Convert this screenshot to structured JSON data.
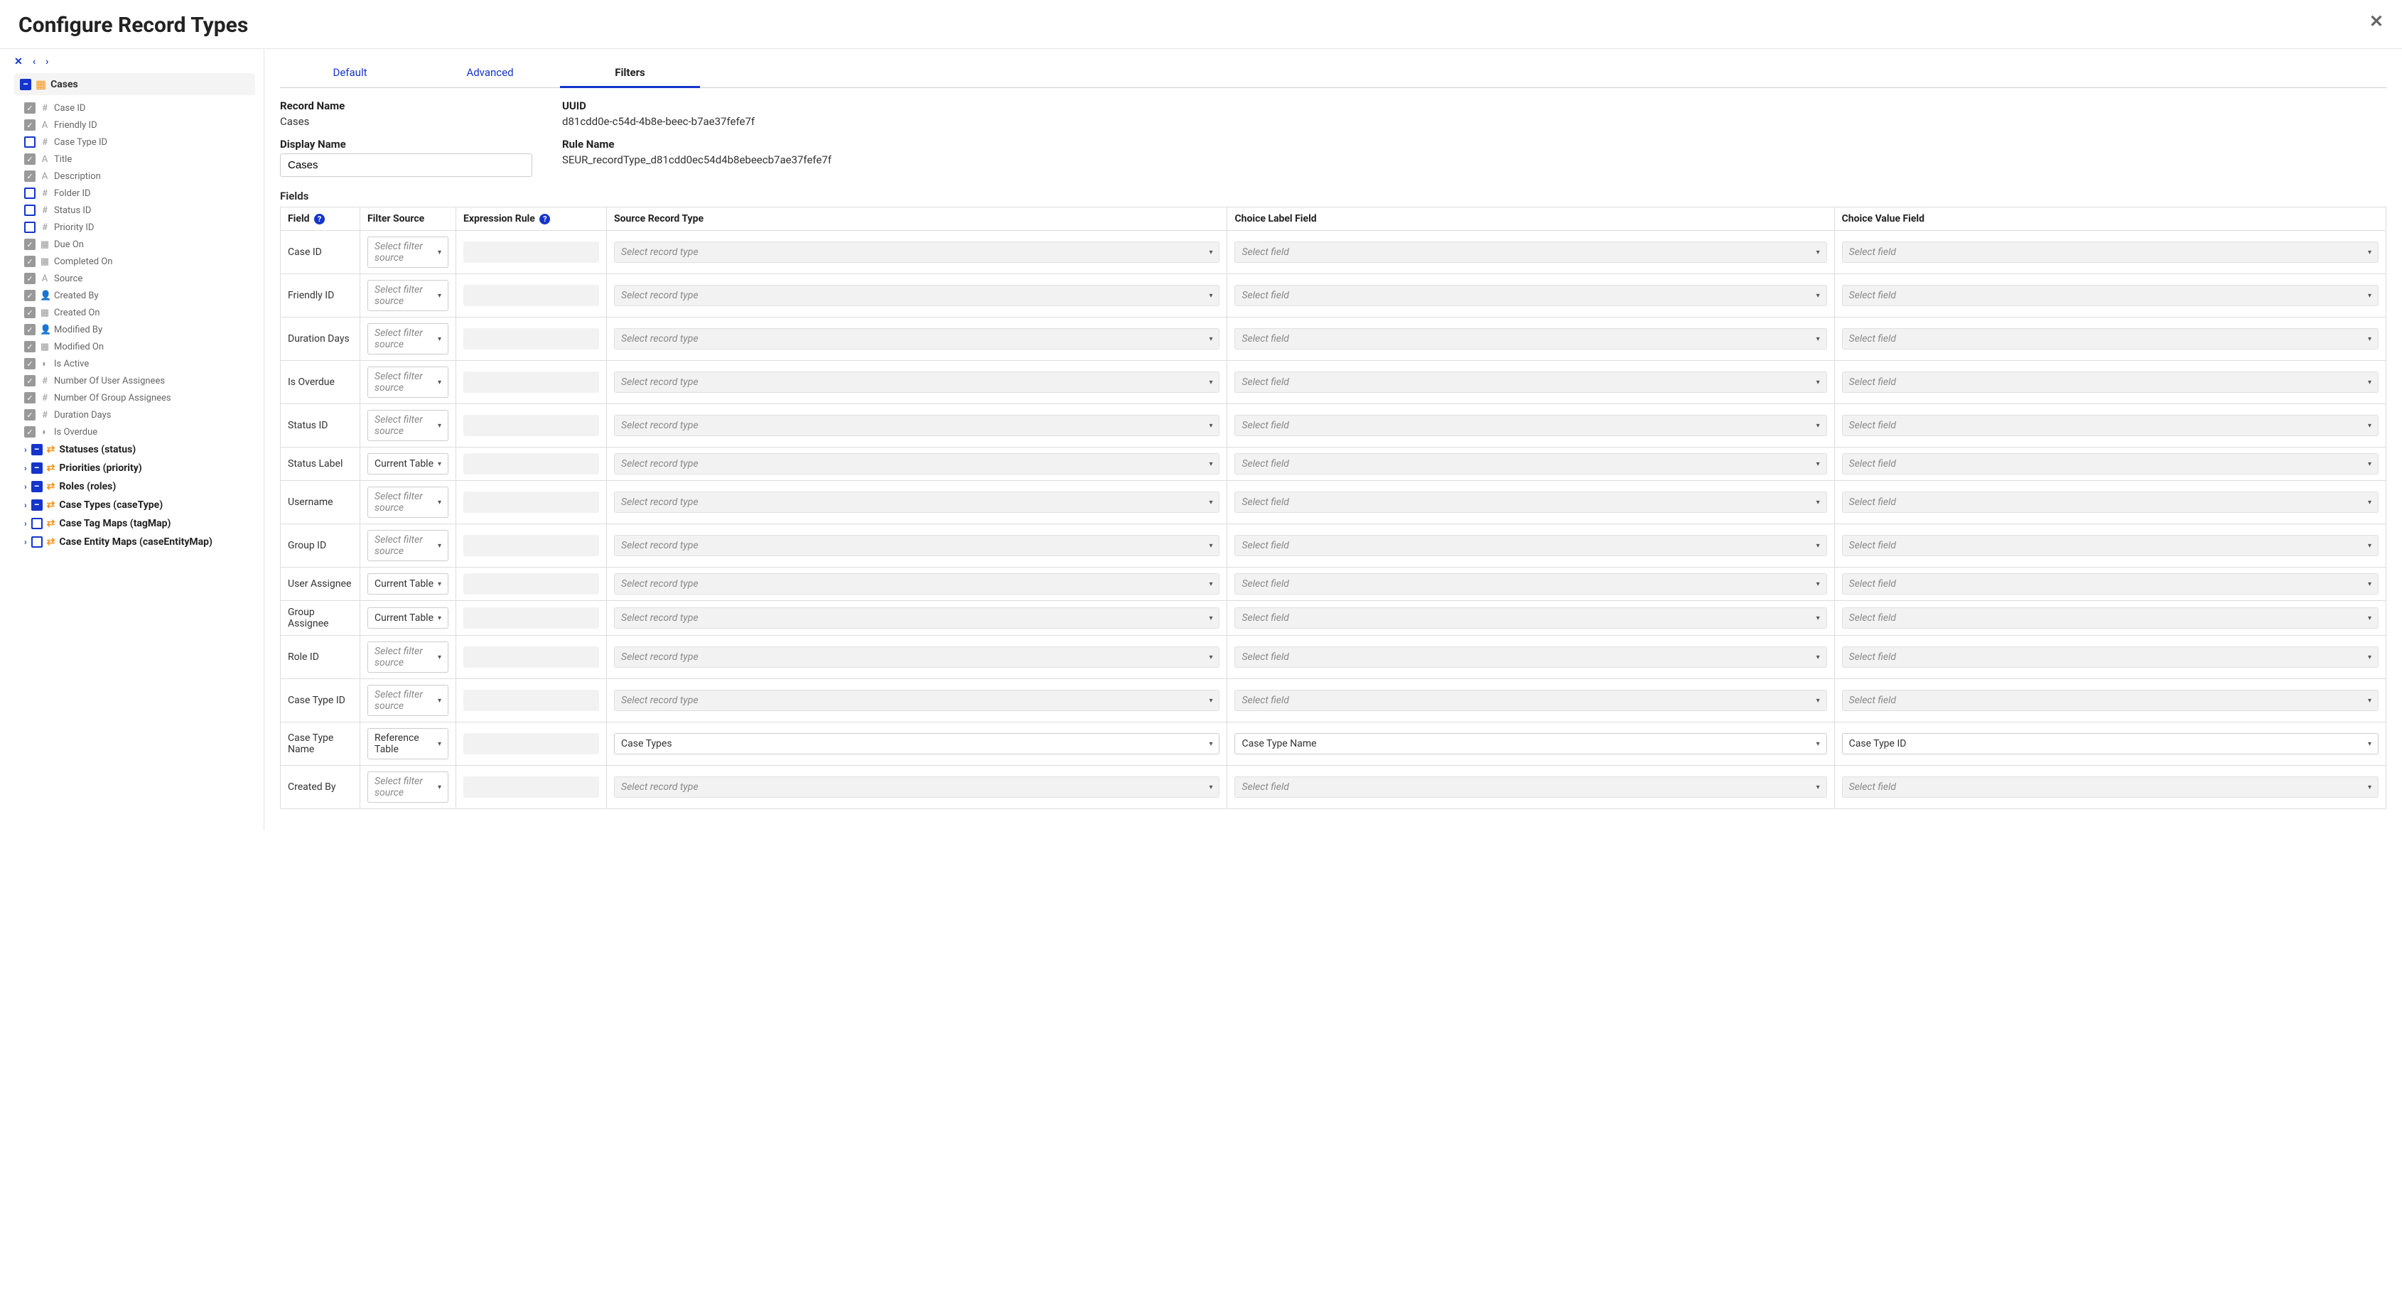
{
  "header": {
    "title": "Configure Record Types"
  },
  "sidebar": {
    "root": {
      "label": "Cases"
    },
    "fields": [
      {
        "checked": true,
        "icon": "#",
        "label": "Case ID"
      },
      {
        "checked": true,
        "icon": "A",
        "label": "Friendly ID"
      },
      {
        "checked": false,
        "icon": "#",
        "label": "Case Type ID"
      },
      {
        "checked": true,
        "icon": "A",
        "label": "Title"
      },
      {
        "checked": true,
        "icon": "A",
        "label": "Description"
      },
      {
        "checked": false,
        "icon": "#",
        "label": "Folder ID"
      },
      {
        "checked": false,
        "icon": "#",
        "label": "Status ID"
      },
      {
        "checked": false,
        "icon": "#",
        "label": "Priority ID"
      },
      {
        "checked": true,
        "icon": "cal",
        "label": "Due On"
      },
      {
        "checked": true,
        "icon": "cal",
        "label": "Completed On"
      },
      {
        "checked": true,
        "icon": "A",
        "label": "Source"
      },
      {
        "checked": true,
        "icon": "user",
        "label": "Created By"
      },
      {
        "checked": true,
        "icon": "cal",
        "label": "Created On"
      },
      {
        "checked": true,
        "icon": "user",
        "label": "Modified By"
      },
      {
        "checked": true,
        "icon": "cal",
        "label": "Modified On"
      },
      {
        "checked": true,
        "icon": "half",
        "label": "Is Active"
      },
      {
        "checked": true,
        "icon": "#",
        "label": "Number Of User Assignees"
      },
      {
        "checked": true,
        "icon": "#",
        "label": "Number Of Group Assignees"
      },
      {
        "checked": true,
        "icon": "#",
        "label": "Duration Days"
      },
      {
        "checked": true,
        "icon": "half",
        "label": "Is Overdue"
      }
    ],
    "groups": [
      {
        "box": "minus",
        "label": "Statuses (status)"
      },
      {
        "box": "minus",
        "label": "Priorities (priority)"
      },
      {
        "box": "minus",
        "label": "Roles (roles)"
      },
      {
        "box": "minus",
        "label": "Case Types (caseType)"
      },
      {
        "box": "empty",
        "label": "Case Tag Maps (tagMap)"
      },
      {
        "box": "empty",
        "label": "Case Entity Maps (caseEntityMap)"
      }
    ]
  },
  "tabs": [
    {
      "label": "Default",
      "active": false
    },
    {
      "label": "Advanced",
      "active": false
    },
    {
      "label": "Filters",
      "active": true
    }
  ],
  "info": {
    "record_name_label": "Record Name",
    "record_name_value": "Cases",
    "uuid_label": "UUID",
    "uuid_value": "d81cdd0e-c54d-4b8e-beec-b7ae37fefe7f",
    "display_name_label": "Display Name",
    "display_name_value": "Cases",
    "rule_name_label": "Rule Name",
    "rule_name_value": "SEUR_recordType_d81cdd0ec54d4b8ebeecb7ae37fefe7f"
  },
  "fields_section_title": "Fields",
  "table": {
    "headers": {
      "field": "Field",
      "filter_source": "Filter Source",
      "expression_rule": "Expression Rule",
      "source_record_type": "Source Record Type",
      "choice_label_field": "Choice Label Field",
      "choice_value_field": "Choice Value Field"
    },
    "placeholders": {
      "filter_source": "Select filter source",
      "record_type": "Select record type",
      "field": "Select field"
    },
    "rows": [
      {
        "field": "Case ID",
        "filter_source": "",
        "source_record": "",
        "label_field": "",
        "value_field": ""
      },
      {
        "field": "Friendly ID",
        "filter_source": "",
        "source_record": "",
        "label_field": "",
        "value_field": ""
      },
      {
        "field": "Duration Days",
        "filter_source": "",
        "source_record": "",
        "label_field": "",
        "value_field": ""
      },
      {
        "field": "Is Overdue",
        "filter_source": "",
        "source_record": "",
        "label_field": "",
        "value_field": ""
      },
      {
        "field": "Status ID",
        "filter_source": "",
        "source_record": "",
        "label_field": "",
        "value_field": ""
      },
      {
        "field": "Status Label",
        "filter_source": "Current Table",
        "source_record": "",
        "label_field": "",
        "value_field": ""
      },
      {
        "field": "Username",
        "filter_source": "",
        "source_record": "",
        "label_field": "",
        "value_field": ""
      },
      {
        "field": "Group ID",
        "filter_source": "",
        "source_record": "",
        "label_field": "",
        "value_field": ""
      },
      {
        "field": "User Assignee",
        "filter_source": "Current Table",
        "source_record": "",
        "label_field": "",
        "value_field": ""
      },
      {
        "field": "Group Assignee",
        "filter_source": "Current Table",
        "source_record": "",
        "label_field": "",
        "value_field": ""
      },
      {
        "field": "Role ID",
        "filter_source": "",
        "source_record": "",
        "label_field": "",
        "value_field": ""
      },
      {
        "field": "Case Type ID",
        "filter_source": "",
        "source_record": "",
        "label_field": "",
        "value_field": ""
      },
      {
        "field": "Case Type Name",
        "filter_source": "Reference Table",
        "source_record": "Case Types",
        "label_field": "Case Type Name",
        "value_field": "Case Type ID"
      },
      {
        "field": "Created By",
        "filter_source": "",
        "source_record": "",
        "label_field": "",
        "value_field": ""
      }
    ]
  },
  "icons": {
    "hash": "#",
    "text": "A",
    "cal": "▦",
    "user": "👤",
    "half": "◐"
  }
}
